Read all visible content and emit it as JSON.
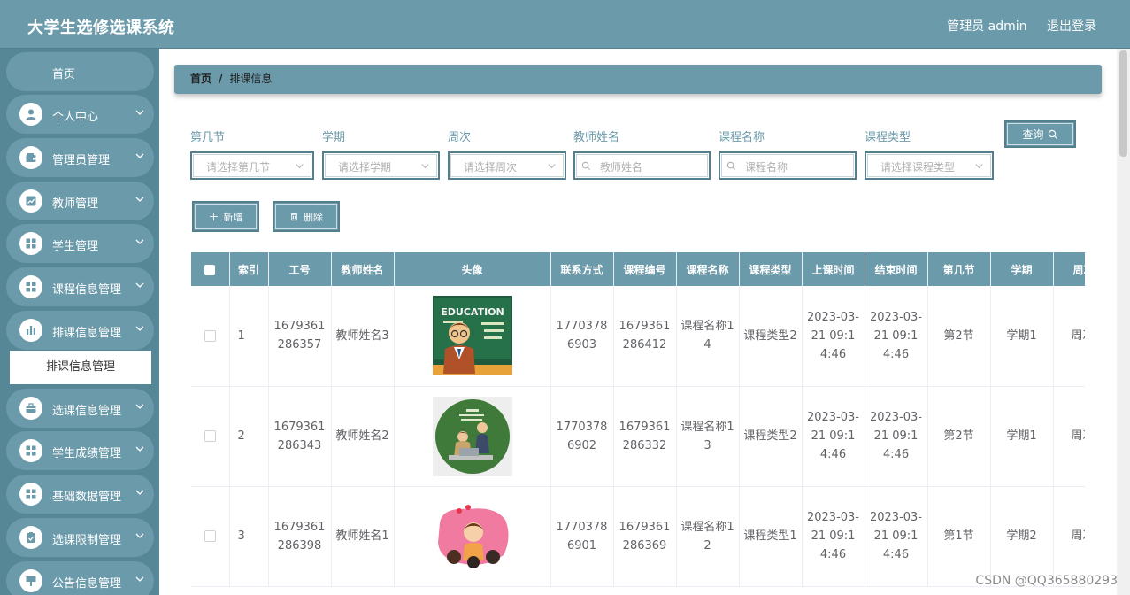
{
  "header": {
    "app_title": "大学生选修选课系统",
    "user_label": "管理员 admin",
    "logout_label": "退出登录"
  },
  "sidebar": {
    "home": "首页",
    "items": [
      {
        "label": "个人中心",
        "icon": "user-icon"
      },
      {
        "label": "管理员管理",
        "icon": "wallet-icon"
      },
      {
        "label": "教师管理",
        "icon": "chart-icon"
      },
      {
        "label": "学生管理",
        "icon": "grid-icon"
      },
      {
        "label": "课程信息管理",
        "icon": "grid-icon"
      },
      {
        "label": "排课信息管理",
        "icon": "bar-chart-icon"
      },
      {
        "label": "选课信息管理",
        "icon": "briefcase-icon"
      },
      {
        "label": "学生成绩管理",
        "icon": "grid-icon"
      },
      {
        "label": "基础数据管理",
        "icon": "grid-icon"
      },
      {
        "label": "选课限制管理",
        "icon": "clipboard-icon"
      },
      {
        "label": "公告信息管理",
        "icon": "bulletin-icon"
      }
    ],
    "active_submenu": "排课信息管理"
  },
  "breadcrumb": {
    "home": "首页",
    "separator": "/",
    "current": "排课信息"
  },
  "filters": [
    {
      "label": "第几节",
      "placeholder": "请选择第几节",
      "kind": "select"
    },
    {
      "label": "学期",
      "placeholder": "请选择学期",
      "kind": "select"
    },
    {
      "label": "周次",
      "placeholder": "请选择周次",
      "kind": "select"
    },
    {
      "label": "教师姓名",
      "placeholder": "教师姓名",
      "kind": "input"
    },
    {
      "label": "课程名称",
      "placeholder": "课程名称",
      "kind": "input"
    },
    {
      "label": "课程类型",
      "placeholder": "请选择课程类型",
      "kind": "select"
    }
  ],
  "buttons": {
    "query": "查询",
    "add": "新增",
    "delete": "删除"
  },
  "table": {
    "columns": [
      "索引",
      "工号",
      "教师姓名",
      "头像",
      "联系方式",
      "课程编号",
      "课程名称",
      "课程类型",
      "上课时间",
      "结束时间",
      "第几节",
      "学期",
      "周次"
    ],
    "rows": [
      {
        "index": "1",
        "job_no": "1679361286357",
        "teacher": "教师姓名3",
        "avatar": "education-teacher",
        "phone": "17703786903",
        "course_no": "1679361286412",
        "course_name": "课程名称14",
        "course_type": "课程类型2",
        "start": "2023-03-21 09:14:46",
        "end": "2023-03-21 09:14:46",
        "section": "第2节",
        "term": "学期1",
        "week": "周次"
      },
      {
        "index": "2",
        "job_no": "1679361286343",
        "teacher": "教师姓名2",
        "avatar": "classroom-circle",
        "phone": "17703786902",
        "course_no": "1679361286332",
        "course_name": "课程名称13",
        "course_type": "课程类型2",
        "start": "2023-03-21 09:14:46",
        "end": "2023-03-21 09:14:46",
        "section": "第2节",
        "term": "学期1",
        "week": "周次"
      },
      {
        "index": "3",
        "job_no": "1679361286398",
        "teacher": "教师姓名1",
        "avatar": "group-pink",
        "phone": "17703786901",
        "course_no": "1679361286369",
        "course_name": "课程名称12",
        "course_type": "课程类型1",
        "start": "2023-03-21 09:14:46",
        "end": "2023-03-21 09:14:46",
        "section": "第1节",
        "term": "学期2",
        "week": "周次"
      }
    ]
  },
  "watermark": "CSDN @QQ365880293",
  "colors": {
    "primary": "#6b9aaa",
    "sidebar_bg": "#558796",
    "border_dark": "#557f8d"
  }
}
